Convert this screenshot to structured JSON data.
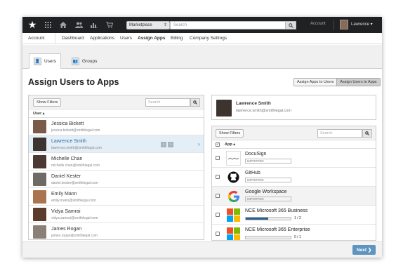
{
  "topbar": {
    "marketplace": "Marketplace",
    "search_placeholder": "Search",
    "account": "Account",
    "user": "Lawrence ▾"
  },
  "nav": {
    "items": [
      "Account",
      "Dashboard",
      "Applications",
      "Users",
      "Assign Apps",
      "Billing",
      "Company Settings"
    ],
    "active": "Assign Apps"
  },
  "tabs": [
    {
      "label": "Users",
      "active": true
    },
    {
      "label": "Groups",
      "active": false
    }
  ],
  "page": {
    "title": "Assign Users to Apps",
    "mode_buttons": [
      "Assign Apps to Users",
      "Assign Users to Apps"
    ],
    "selected_mode": "Assign Users to Apps"
  },
  "users_panel": {
    "show_filters": "Show Filters",
    "search_placeholder": "Search",
    "column": "User ▴",
    "users": [
      {
        "name": "Jessica Bickett",
        "email": "jessica.bickett@smithlegal.com",
        "selected": false
      },
      {
        "name": "Lawrence Smith",
        "email": "lawrence.smith@smithlegal.com",
        "selected": true
      },
      {
        "name": "Michelle Chan",
        "email": "michelle.chan@smithlegal.com",
        "selected": false
      },
      {
        "name": "Daniel Kester",
        "email": "daniel.kester@smithlegal.com",
        "selected": false
      },
      {
        "name": "Emily Mann",
        "email": "emily.mann@smithlegal.com",
        "selected": false
      },
      {
        "name": "Vidya Samrai",
        "email": "vidya.samrai@smithlegal.com",
        "selected": false
      },
      {
        "name": "James Rogan",
        "email": "james.rogan@smithlegal.com",
        "selected": false
      }
    ]
  },
  "selected_user": {
    "name": "Lawrence Smith",
    "email": "lawrence.smith@smithlegal.com"
  },
  "apps_panel": {
    "show_filters": "Show Filters",
    "search_placeholder": "Search",
    "column": "App ▴",
    "apps": [
      {
        "name": "DocuSign",
        "tag": "IMPORTED",
        "icon": "docusign-logo"
      },
      {
        "name": "GitHub",
        "tag": "IMPORTED",
        "icon": "github-logo"
      },
      {
        "name": "Google Workspace",
        "tag": "IMPORTED",
        "icon": "google-logo"
      },
      {
        "name": "NCE Microsoft 365 Business",
        "license": "1 / 2",
        "fill": 0.5,
        "icon": "microsoft-logo"
      },
      {
        "name": "NCE Microsoft 365 Enterprise",
        "license": "0 / 1",
        "fill": 0.0,
        "icon": "microsoft-logo"
      }
    ]
  },
  "footer": {
    "next": "Next ❯"
  },
  "colors": {
    "topbar": "#1f2123",
    "accent": "#2a6ea8",
    "next_button": "#5e94bf",
    "license_fill": "#2d5f8e"
  }
}
